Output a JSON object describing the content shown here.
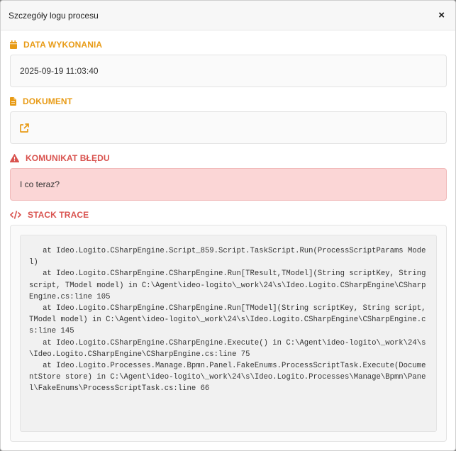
{
  "modal": {
    "title": "Szczegóły logu procesu",
    "close_label": "×"
  },
  "sections": {
    "date": {
      "heading": "DATA WYKONANIA",
      "value": "2025-09-19 11:03:40",
      "icon": "calendar-icon"
    },
    "document": {
      "heading": "DOKUMENT",
      "icon": "file-icon",
      "link_icon": "external-link-icon"
    },
    "error": {
      "heading": "KOMUNIKAT BŁĘDU",
      "value": "I co teraz?",
      "icon": "warning-icon"
    },
    "stack": {
      "heading": "STACK TRACE",
      "icon": "code-icon",
      "value": "   at Ideo.Logito.CSharpEngine.Script_859.Script.TaskScript.Run(ProcessScriptParams Model)\n   at Ideo.Logito.CSharpEngine.CSharpEngine.Run[TResult,TModel](String scriptKey, String script, TModel model) in C:\\Agent\\ideo-logito\\_work\\24\\s\\Ideo.Logito.CSharpEngine\\CSharpEngine.cs:line 105\n   at Ideo.Logito.CSharpEngine.CSharpEngine.Run[TModel](String scriptKey, String script, TModel model) in C:\\Agent\\ideo-logito\\_work\\24\\s\\Ideo.Logito.CSharpEngine\\CSharpEngine.cs:line 145\n   at Ideo.Logito.CSharpEngine.CSharpEngine.Execute() in C:\\Agent\\ideo-logito\\_work\\24\\s\\Ideo.Logito.CSharpEngine\\CSharpEngine.cs:line 75\n   at Ideo.Logito.Processes.Manage.Bpmn.Panel.FakeEnums.ProcessScriptTask.Execute(DocumentStore store) in C:\\Agent\\ideo-logito\\_work\\24\\s\\Ideo.Logito.Processes\\Manage\\Bpmn\\Panel\\FakeEnums\\ProcessScriptTask.cs:line 66"
    }
  },
  "colors": {
    "accent_orange": "#e89b16",
    "accent_red": "#d9534f",
    "error_background": "#fbd6d6"
  }
}
